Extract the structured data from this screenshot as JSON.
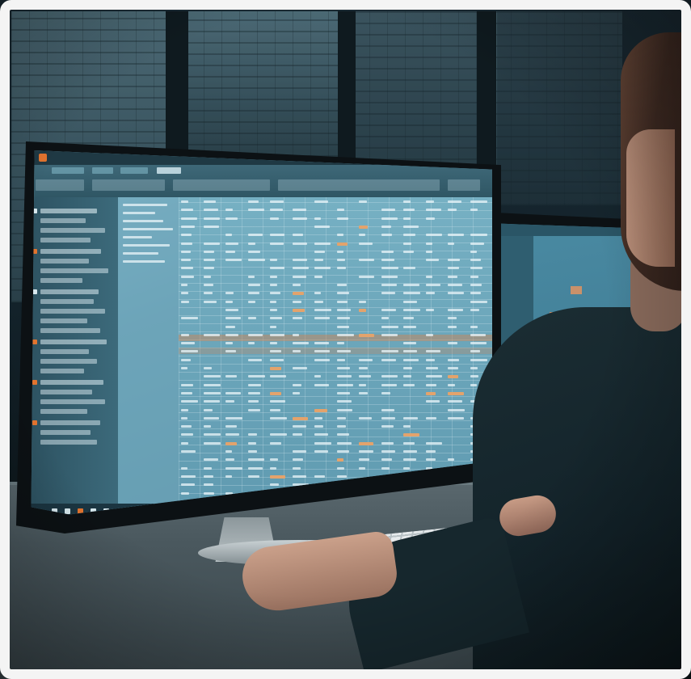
{
  "image": {
    "kind": "photograph",
    "colors": {
      "background": "#13222a",
      "screen": "#6aa5b9",
      "highlight": "#e3a36c",
      "desk": "#4a585e"
    }
  },
  "screen": {
    "main_monitor": {
      "menu_label": "",
      "icons": [
        "app-logo-icon",
        "grid-icon",
        "folder-icon",
        "chart-icon"
      ]
    }
  }
}
